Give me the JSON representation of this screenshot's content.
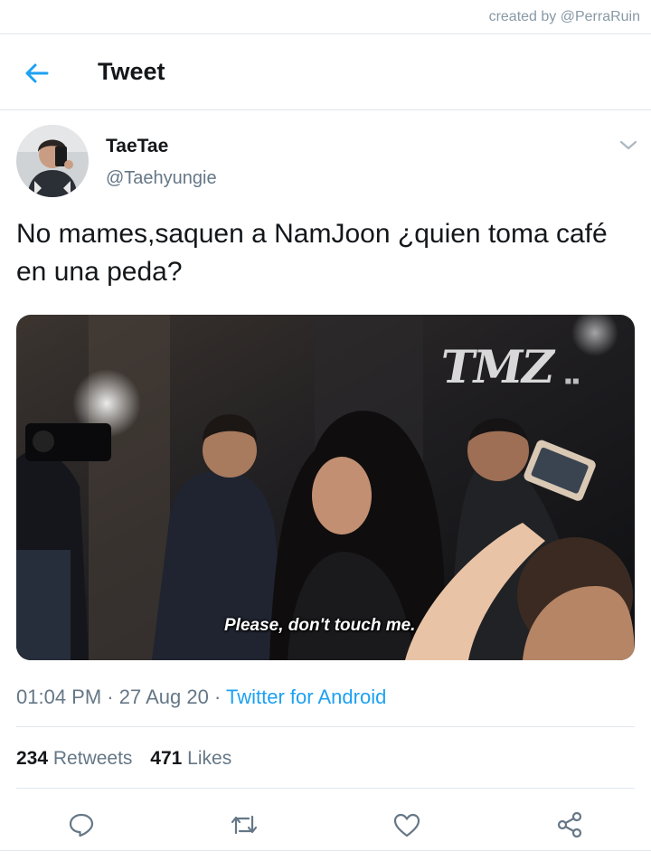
{
  "watermark": "created by @PerraRuin",
  "header": {
    "title": "Tweet",
    "back_icon": "arrow-left-icon"
  },
  "tweet": {
    "display_name": "TaeTae",
    "handle": "@Taehyungie",
    "text": "No mames,saquen a NamJoon ¿quien toma café en una peda?",
    "media": {
      "overlay_logo": "TMZ",
      "subtitle": "Please, don't touch me."
    },
    "time": "01:04 PM",
    "date": "27 Aug 20",
    "source": "Twitter for Android",
    "separator": "·",
    "retweets_count": "234",
    "retweets_label": "Retweets",
    "likes_count": "471",
    "likes_label": "Likes"
  },
  "actions": [
    "reply-icon",
    "retweet-icon",
    "like-icon",
    "share-icon"
  ],
  "colors": {
    "accent": "#1da1f2",
    "text": "#14171a",
    "secondary": "#657786",
    "border": "#e1e8ed"
  }
}
